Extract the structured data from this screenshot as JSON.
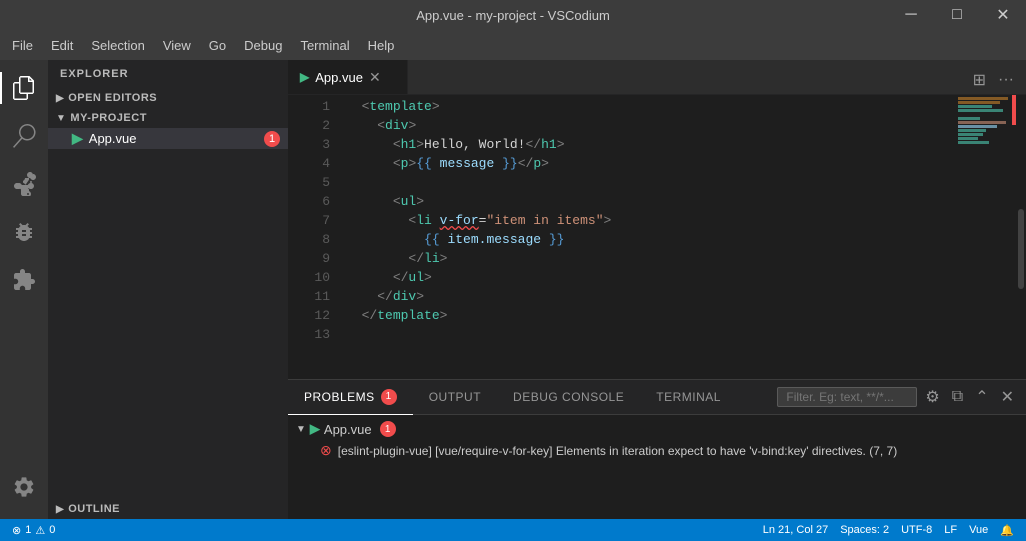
{
  "titleBar": {
    "title": "App.vue - my-project - VSCodium",
    "minimize": "─",
    "maximize": "□",
    "close": "✕"
  },
  "menuBar": {
    "items": [
      {
        "id": "file",
        "label": "File"
      },
      {
        "id": "edit",
        "label": "Edit"
      },
      {
        "id": "selection",
        "label": "Selection"
      },
      {
        "id": "view",
        "label": "View"
      },
      {
        "id": "go",
        "label": "Go"
      },
      {
        "id": "debug",
        "label": "Debug"
      },
      {
        "id": "terminal",
        "label": "Terminal"
      },
      {
        "id": "help",
        "label": "Help"
      }
    ]
  },
  "sidebar": {
    "header": "Explorer",
    "sections": [
      {
        "id": "open-editors",
        "label": "Open Editors",
        "expanded": false
      },
      {
        "id": "my-project",
        "label": "My-Project",
        "expanded": true,
        "files": [
          {
            "name": "App.vue",
            "active": true,
            "badge": "1",
            "type": "vue"
          }
        ]
      },
      {
        "id": "outline",
        "label": "Outline",
        "expanded": false
      }
    ]
  },
  "tab": {
    "label": "App.vue",
    "active": true
  },
  "codeLines": [
    {
      "num": 1,
      "content": "  <template>"
    },
    {
      "num": 2,
      "content": "    <div>"
    },
    {
      "num": 3,
      "content": "      <h1>Hello, World!</h1>"
    },
    {
      "num": 4,
      "content": "      <p>{{ message }}</p>"
    },
    {
      "num": 5,
      "content": ""
    },
    {
      "num": 6,
      "content": "      <ul>"
    },
    {
      "num": 7,
      "content": "        <li v-for=\"item in items\">"
    },
    {
      "num": 8,
      "content": "          {{ item.message }}"
    },
    {
      "num": 9,
      "content": "        </li>"
    },
    {
      "num": 10,
      "content": "      </ul>"
    },
    {
      "num": 11,
      "content": "    </div>"
    },
    {
      "num": 12,
      "content": "  </template>"
    },
    {
      "num": 13,
      "content": ""
    }
  ],
  "panel": {
    "tabs": [
      {
        "id": "problems",
        "label": "Problems",
        "active": true,
        "badge": "1"
      },
      {
        "id": "output",
        "label": "Output",
        "active": false
      },
      {
        "id": "debug-console",
        "label": "Debug Console",
        "active": false
      },
      {
        "id": "terminal",
        "label": "Terminal",
        "active": false
      }
    ],
    "filter": {
      "placeholder": "Filter. Eg: text, **/*..."
    },
    "problems": [
      {
        "file": "App.vue",
        "badge": "1",
        "items": [
          {
            "message": "[eslint-plugin-vue] [vue/require-v-for-key] Elements in iteration expect to have 'v-bind:key' directives.",
            "location": "(7, 7)"
          }
        ]
      }
    ]
  },
  "statusBar": {
    "errors": "1",
    "warnings": "0",
    "position": "Ln 21, Col 27",
    "spaces": "Spaces: 2",
    "encoding": "UTF-8",
    "lineEnding": "LF",
    "language": "Vue",
    "bell": "🔔"
  }
}
